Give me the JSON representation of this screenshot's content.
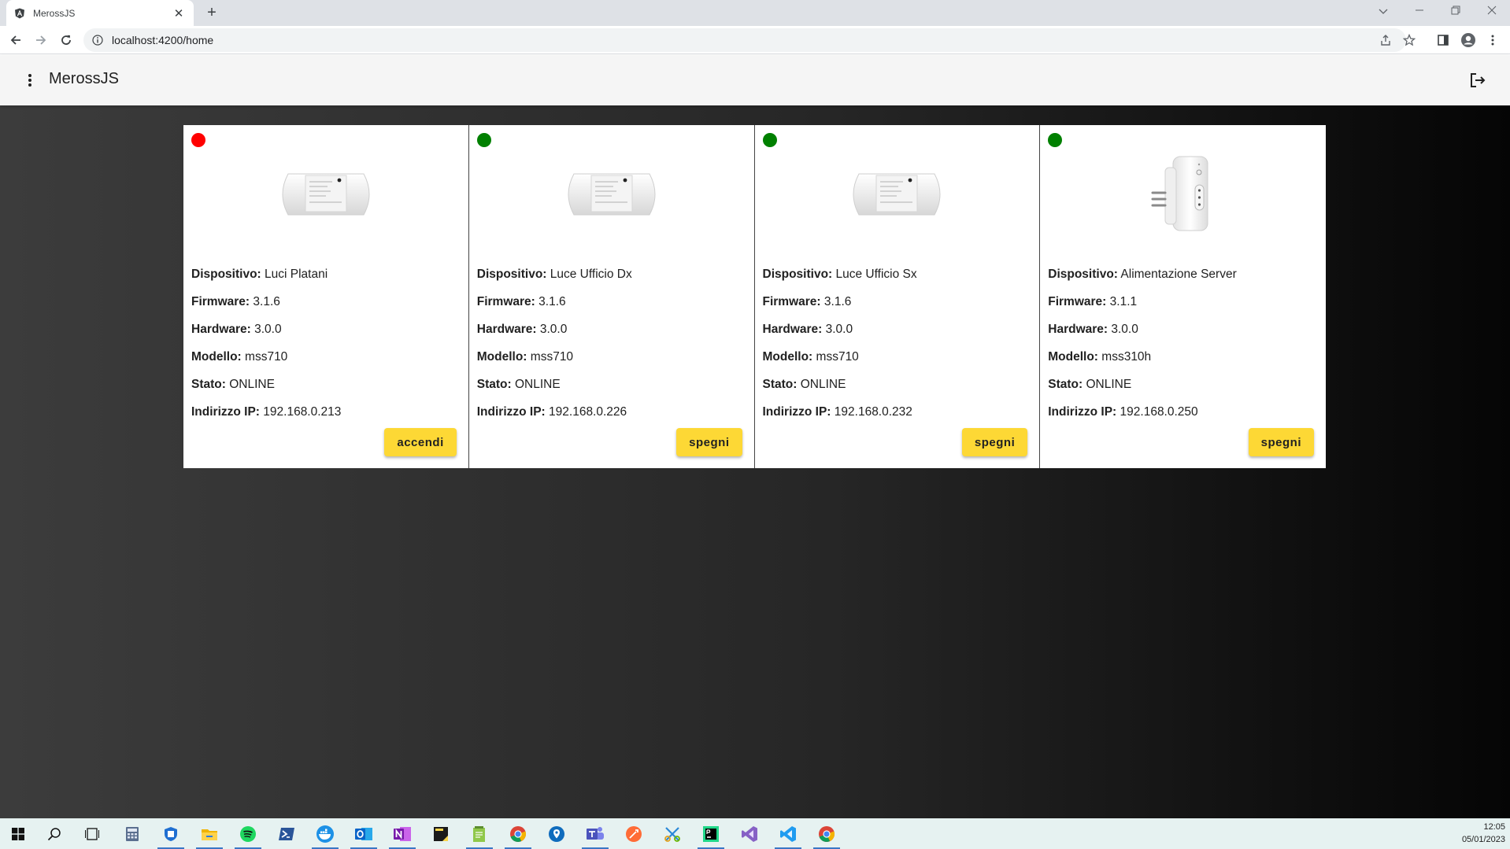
{
  "browser": {
    "tab_title": "MerossJS",
    "tab_close": "✕",
    "new_tab": "+",
    "url": "localhost:4200/home"
  },
  "app": {
    "title": "MerossJS"
  },
  "labels": {
    "device": "Dispositivo:",
    "firmware": "Firmware:",
    "hardware": "Hardware:",
    "model": "Modello:",
    "status": "Stato:",
    "ip": "Indirizzo IP:"
  },
  "devices": [
    {
      "name": "Luci Platani",
      "firmware": "3.1.6",
      "hardware": "3.0.0",
      "model": "mss710",
      "status": "ONLINE",
      "ip": "192.168.0.213",
      "indicator_color": "#ff0000",
      "action": "accendi",
      "image": "smart-switch-image"
    },
    {
      "name": "Luce Ufficio Dx",
      "firmware": "3.1.6",
      "hardware": "3.0.0",
      "model": "mss710",
      "status": "ONLINE",
      "ip": "192.168.0.226",
      "indicator_color": "#008000",
      "action": "spegni",
      "image": "smart-switch-image"
    },
    {
      "name": "Luce Ufficio Sx",
      "firmware": "3.1.6",
      "hardware": "3.0.0",
      "model": "mss710",
      "status": "ONLINE",
      "ip": "192.168.0.232",
      "indicator_color": "#008000",
      "action": "spegni",
      "image": "smart-switch-image"
    },
    {
      "name": "Alimentazione Server",
      "firmware": "3.1.1",
      "hardware": "3.0.0",
      "model": "mss310h",
      "status": "ONLINE",
      "ip": "192.168.0.250",
      "indicator_color": "#008000",
      "action": "spegni",
      "image": "smart-plug-image"
    }
  ],
  "taskbar": {
    "time": "12:05",
    "date": "05/01/2023"
  },
  "colors": {
    "button_accent": "#fdd835",
    "indicator_off": "#ff0000",
    "indicator_on": "#008000"
  }
}
